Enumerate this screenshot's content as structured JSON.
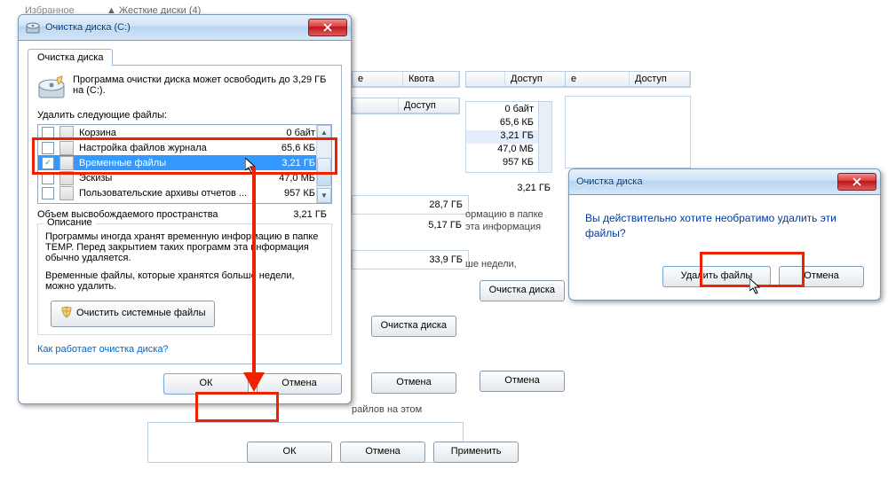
{
  "topbar": {
    "favorites": "Избранное",
    "disks": "Жесткие диски (4)"
  },
  "win_main": {
    "title": "Очистка диска (C:)",
    "tab": "Очистка диска",
    "summary": "Программа очистки диска может освободить до 3,29 ГБ на (C:).",
    "delete_label": "Удалить следующие файлы:",
    "files": [
      {
        "name": "Корзина",
        "size": "0 байт",
        "checked": false
      },
      {
        "name": "Настройка файлов журнала",
        "size": "65,6 КБ",
        "checked": false
      },
      {
        "name": "Временные файлы",
        "size": "3,21 ГБ",
        "checked": true,
        "selected": true
      },
      {
        "name": "Эскизы",
        "size": "47,0 МБ",
        "checked": false
      },
      {
        "name": "Пользовательские архивы отчетов ...",
        "size": "957 КБ",
        "checked": false
      }
    ],
    "total_label": "Объем высвобождаемого пространства",
    "total_value": "3,21 ГБ",
    "desc_title": "Описание",
    "desc_para1": "Программы иногда хранят временную информацию в папке TEMP. Перед закрытием таких программ эта информация обычно удаляется.",
    "desc_para2": "Временные файлы, которые хранятся больше недели, можно удалить.",
    "sys_btn": "Очистить системные файлы",
    "link": "Как работает очистка диска?",
    "ok": "ОК",
    "cancel": "Отмена"
  },
  "win_confirm": {
    "title": "Очистка диска",
    "message": "Вы действительно хотите необратимо удалить эти файлы?",
    "delete_btn": "Удалить файлы",
    "cancel_btn": "Отмена"
  },
  "bg": {
    "col_quota": "Квота",
    "col_access": "Доступ",
    "sizes": [
      "0 байт",
      "65,6 КБ",
      "3,21 ГБ",
      "47,0 МБ",
      "957 КБ"
    ],
    "total2": "3,21 ГБ",
    "v1": "28,7 ГБ",
    "v2": "5,17 ГБ",
    "v3": "33,9 ГБ",
    "snip1": "ормацию в папке",
    "snip2": "эта информация",
    "snip3": "ше недели,",
    "cleanup_btn": "Очистка диска",
    "files_on": "райлов на этом",
    "ok": "ОК",
    "cancel": "Отмена",
    "apply": "Применить"
  }
}
